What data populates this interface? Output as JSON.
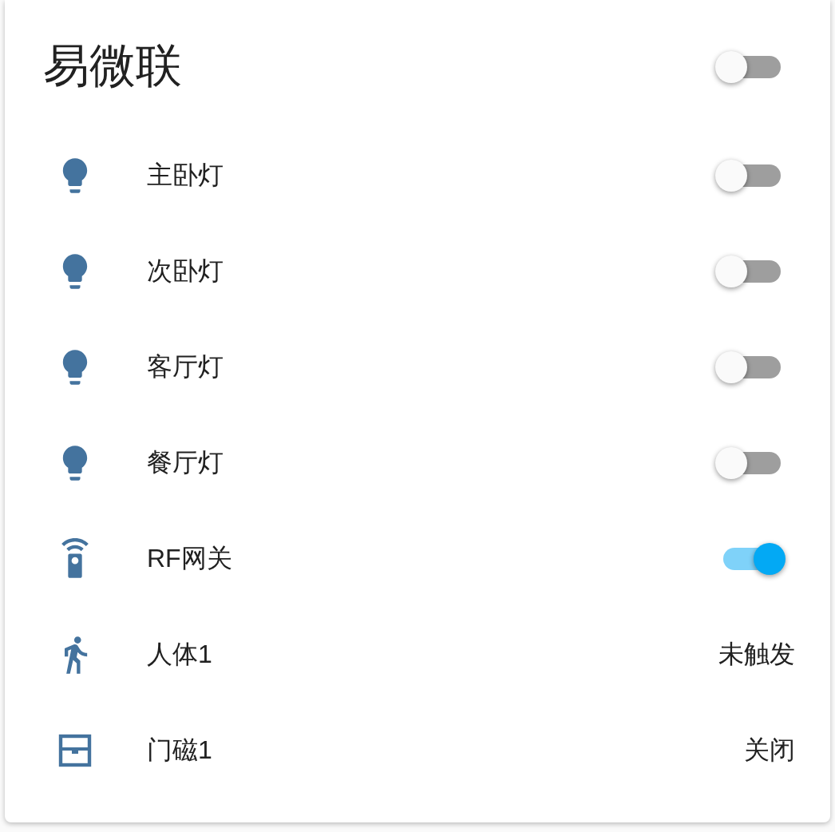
{
  "card": {
    "title": "易微联",
    "title_toggle": {
      "on": false
    },
    "entities": [
      {
        "kind": "light",
        "name": "主卧灯",
        "on": false
      },
      {
        "kind": "light",
        "name": "次卧灯",
        "on": false
      },
      {
        "kind": "light",
        "name": "客厅灯",
        "on": false
      },
      {
        "kind": "light",
        "name": "餐厅灯",
        "on": false
      },
      {
        "kind": "remote",
        "name": "RF网关",
        "on": true
      },
      {
        "kind": "motion",
        "name": "人体1",
        "state": "未触发"
      },
      {
        "kind": "door",
        "name": "门磁1",
        "state": "关闭"
      }
    ]
  }
}
